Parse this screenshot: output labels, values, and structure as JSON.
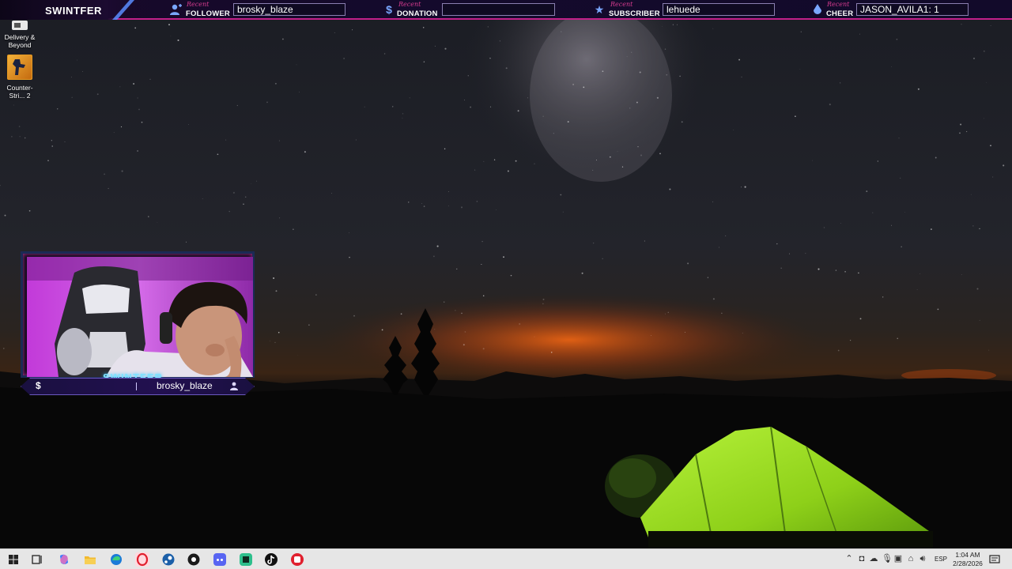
{
  "overlay": {
    "brand": "SWINTFER",
    "alerts": [
      {
        "icon": "user-plus-icon",
        "recent": "Recent",
        "kind": "FOLLOWER",
        "value": "brosky_blaze"
      },
      {
        "icon": "dollar-icon",
        "recent": "Recent",
        "kind": "DONATION",
        "value": ""
      },
      {
        "icon": "star-icon",
        "recent": "Recent",
        "kind": "SUBSCRIBER",
        "value": "lehuede"
      },
      {
        "icon": "drop-icon",
        "recent": "Recent",
        "kind": "CHEER",
        "value": "JASON_AVILA1: 1"
      }
    ],
    "accent": "#c2208a"
  },
  "desktop": {
    "icons": [
      {
        "label": "Delivery & Beyond"
      },
      {
        "label": "Counter-Stri... 2"
      }
    ]
  },
  "webcam": {
    "watermark": "SWINTFER",
    "dollar": "$",
    "latest_name": "brosky_blaze"
  },
  "taskbar": {
    "apps": [
      "windows-start-icon",
      "task-view-icon",
      "copilot-icon",
      "file-explorer-icon",
      "edge-icon",
      "opera-icon",
      "steam-icon",
      "chrome-dark-icon",
      "discord-icon",
      "obs-icon",
      "tiktok-icon",
      "app-red-icon"
    ],
    "language": "ESP",
    "time": "1:04 AM",
    "date": "2/28/2026"
  }
}
